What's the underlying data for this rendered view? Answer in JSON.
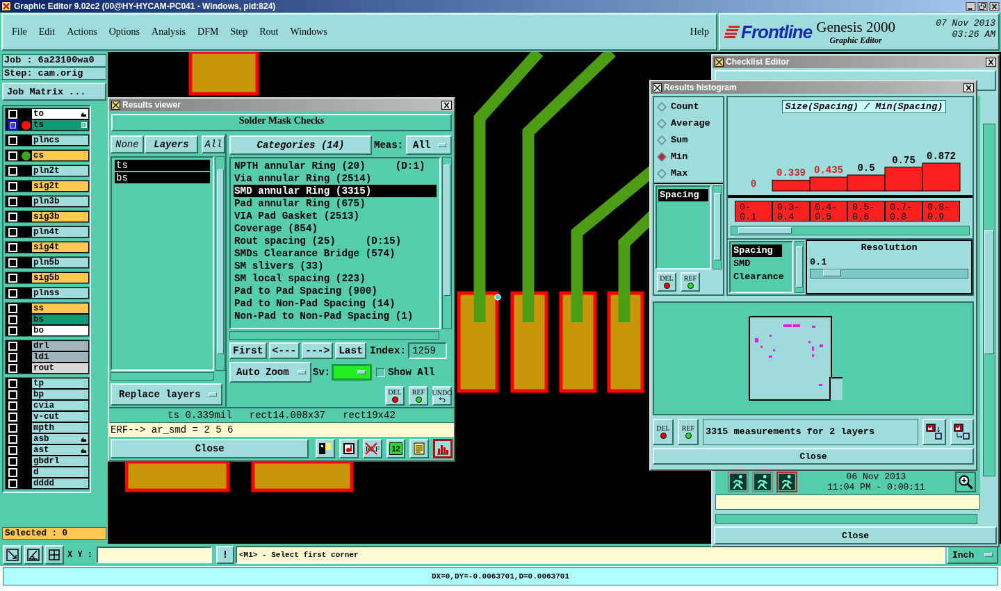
{
  "window": {
    "title": "Graphic Editor 9.02c2 (00@HY-HYCAM-PC041 - Windows, pid:824)"
  },
  "menu": [
    "File",
    "Edit",
    "Actions",
    "Options",
    "Analysis",
    "DFM",
    "Step",
    "Rout",
    "Windows"
  ],
  "help": "Help",
  "brand": {
    "logo": "Frontline",
    "product": "Genesis 2000",
    "subtitle": "Graphic Editor",
    "date": "07 Nov 2013",
    "time": "03:26 AM"
  },
  "job": {
    "job": "Job : 6a23100wa0",
    "step": "Step: cam.orig",
    "matrix_button": "Job Matrix ...",
    "selected": "Selected : 0"
  },
  "layer_groups": [
    [
      {
        "name": "to",
        "color": "#ffffff",
        "kind": "pointer",
        "selected": false
      },
      {
        "name": "ts",
        "color": "#109a78",
        "kind": "grid",
        "selected": true,
        "marker": {
          "color": "#ff1010"
        }
      }
    ],
    [
      {
        "name": "plncs",
        "color": "#a0dcdc",
        "kind": "plain",
        "selected": false
      }
    ],
    [
      {
        "name": "cs",
        "color": "#ffc850",
        "kind": "plain",
        "selected": false,
        "marker": {
          "color": "#40a020"
        }
      }
    ],
    [
      {
        "name": "pln2t",
        "color": "#a0dcdc",
        "kind": "plain",
        "selected": false
      }
    ],
    [
      {
        "name": "sig2t",
        "color": "#ffc850",
        "kind": "plain",
        "selected": false
      }
    ],
    [
      {
        "name": "pln3b",
        "color": "#a0dcdc",
        "kind": "plain",
        "selected": false
      }
    ],
    [
      {
        "name": "sig3b",
        "color": "#ffc850",
        "kind": "plain",
        "selected": false
      }
    ],
    [
      {
        "name": "pln4t",
        "color": "#a0dcdc",
        "kind": "plain",
        "selected": false
      }
    ],
    [
      {
        "name": "sig4t",
        "color": "#ffc850",
        "kind": "plain",
        "selected": false
      }
    ],
    [
      {
        "name": "pln5b",
        "color": "#a0dcdc",
        "kind": "plain",
        "selected": false
      }
    ],
    [
      {
        "name": "sig5b",
        "color": "#ffc850",
        "kind": "plain",
        "selected": false
      }
    ],
    [
      {
        "name": "plnss",
        "color": "#a0dcdc",
        "kind": "plain",
        "selected": false
      }
    ],
    [
      {
        "name": "ss",
        "color": "#ffc850",
        "kind": "plain",
        "selected": false
      },
      {
        "name": "bs",
        "color": "#109a78",
        "kind": "plain",
        "selected": false
      },
      {
        "name": "bo",
        "color": "#ffffff",
        "kind": "plain",
        "selected": false
      }
    ],
    [
      {
        "name": "drl",
        "color": "#a0b4bc",
        "kind": "plain",
        "selected": false
      },
      {
        "name": "ldi",
        "color": "#a0b4bc",
        "kind": "plain",
        "selected": false
      },
      {
        "name": "rout",
        "color": "#d8d8d8",
        "kind": "plain",
        "selected": false
      }
    ],
    [
      {
        "name": "tp",
        "color": "#a0dcdc",
        "kind": "plain",
        "selected": false
      },
      {
        "name": "bp",
        "color": "#a0dcdc",
        "kind": "plain",
        "selected": false
      },
      {
        "name": "cvia",
        "color": "#a0dcdc",
        "kind": "plain",
        "selected": false
      },
      {
        "name": "v-cut",
        "color": "#a0dcdc",
        "kind": "plain",
        "selected": false
      },
      {
        "name": "mpth",
        "color": "#a0dcdc",
        "kind": "plain",
        "selected": false
      },
      {
        "name": "asb",
        "color": "#a0dcdc",
        "kind": "pointer",
        "selected": false
      },
      {
        "name": "ast",
        "color": "#a0dcdc",
        "kind": "pointer",
        "selected": false
      },
      {
        "name": "gbdrl",
        "color": "#a0dcdc",
        "kind": "plain",
        "selected": false
      },
      {
        "name": "d",
        "color": "#a0dcdc",
        "kind": "plain",
        "selected": false
      },
      {
        "name": "dddd",
        "color": "#a0dcdc",
        "kind": "plain",
        "selected": false
      }
    ]
  ],
  "results_viewer": {
    "title": "Results viewer",
    "heading": "Solder Mask Checks",
    "layer_buttons": [
      "None",
      "Layers",
      "All"
    ],
    "layers": [
      {
        "name": "ts",
        "selected": true
      },
      {
        "name": "bs",
        "selected": true
      }
    ],
    "replace_button": "Replace layers",
    "categories_button": "Categories (14)",
    "meas_label": "Meas:",
    "meas_value": "All",
    "categories": [
      {
        "label": "NPTH annular Ring (20)",
        "detail": "(D:1)",
        "selected": false
      },
      {
        "label": "Via annular Ring (2514)",
        "selected": false
      },
      {
        "label": "SMD annular Ring (3315)",
        "selected": true
      },
      {
        "label": "Pad annular Ring (675)",
        "selected": false
      },
      {
        "label": "VIA Pad Gasket (2513)",
        "selected": false
      },
      {
        "label": "Coverage (854)",
        "selected": false
      },
      {
        "label": "Rout spacing (25)",
        "detail": "(D:15)",
        "selected": false
      },
      {
        "label": "SMDs Clearance Bridge (574)",
        "selected": false
      },
      {
        "label": "SM slivers (33)",
        "selected": false
      },
      {
        "label": "SM local spacing (223)",
        "selected": false
      },
      {
        "label": "Pad to Pad Spacing (900)",
        "selected": false
      },
      {
        "label": "Pad to Non-Pad Spacing (14)",
        "selected": false
      },
      {
        "label": "Non-Pad to Non-Pad Spacing (1)",
        "selected": false
      }
    ],
    "nav": [
      "First",
      "<---",
      "--->",
      "Last"
    ],
    "index_label": "Index:",
    "index_value": "1259",
    "zoom_button": "Auto Zoom",
    "sv": {
      "label": "Sv:",
      "color": "#22ee22"
    },
    "show_all": {
      "label": "Show All",
      "checked": false
    },
    "tools": [
      {
        "text": "DEL",
        "kind": "delete"
      },
      {
        "text": "REF",
        "kind": "reference"
      },
      {
        "text": "UNDO",
        "kind": "undo"
      }
    ],
    "info": "ts 0.339mil   rect14.008x37   rect19x42",
    "erf": "ERF--> ar_smd = 2 5 6",
    "close": "Close",
    "bottom_tools": [
      {
        "kind": "layers",
        "selected": false
      },
      {
        "kind": "record",
        "selected": false
      },
      {
        "kind": "ref",
        "text": "REF",
        "selected": false
      },
      {
        "kind": "number",
        "text": "12",
        "selected": false
      },
      {
        "kind": "notes",
        "selected": false
      },
      {
        "kind": "histogram",
        "selected": true
      }
    ]
  },
  "histogram": {
    "title": "Results histogram",
    "functions": [
      {
        "label": "Count",
        "selected": false
      },
      {
        "label": "Average",
        "selected": false
      },
      {
        "label": "Sum",
        "selected": false
      },
      {
        "label": "Min",
        "selected": true
      },
      {
        "label": "Max",
        "selected": false
      }
    ],
    "measures": [
      {
        "label": "Spacing",
        "selected": true
      }
    ],
    "tools": [
      {
        "text": "DEL",
        "kind": "delete"
      },
      {
        "text": "REF",
        "kind": "reference"
      }
    ],
    "chart_data": {
      "type": "bar",
      "title": "Size(Spacing) / Min(Spacing)",
      "categories": [
        "0-0.1",
        "0.3-0.4",
        "0.4-0.5",
        "0.5-0.6",
        "0.7-0.8",
        "0.8-0.9"
      ],
      "series": [
        {
          "color": "#ff2020",
          "values": [
            0,
            0.339,
            0.435,
            0.5,
            0.75,
            0.872
          ]
        }
      ],
      "data_labels": true
    },
    "value_labels": [
      {
        "color": "#cc2222"
      },
      {
        "color": "#cc2222"
      },
      {
        "color": "#cc2222"
      },
      {
        "color": "#000000"
      },
      {
        "color": "#000000"
      },
      {
        "color": "#000000"
      }
    ],
    "types": [
      {
        "label": "Spacing",
        "selected": true
      },
      {
        "label": "SMD",
        "selected": false
      },
      {
        "label": "Clearance",
        "selected": false
      }
    ],
    "resolution": {
      "label": "Resolution",
      "value": "0.1",
      "level": 0.08
    },
    "bottom_tools": [
      {
        "text": "DEL",
        "kind": "delete"
      },
      {
        "text": "REF",
        "kind": "reference"
      }
    ],
    "summary": "3315 measurements for 2 layers",
    "close": "Close"
  },
  "checklist": {
    "title": "Checklist Editor",
    "date": "06 Nov 2013",
    "time": "11:04 PM - 0:00:11",
    "close": "Close"
  },
  "status": {
    "xy_label": "X Y :",
    "warn_button": "!",
    "message": "<M1> - Select first corner",
    "units": "Inch",
    "measure": "DX=0,DY=-0.0063701,D=0.0063701"
  }
}
